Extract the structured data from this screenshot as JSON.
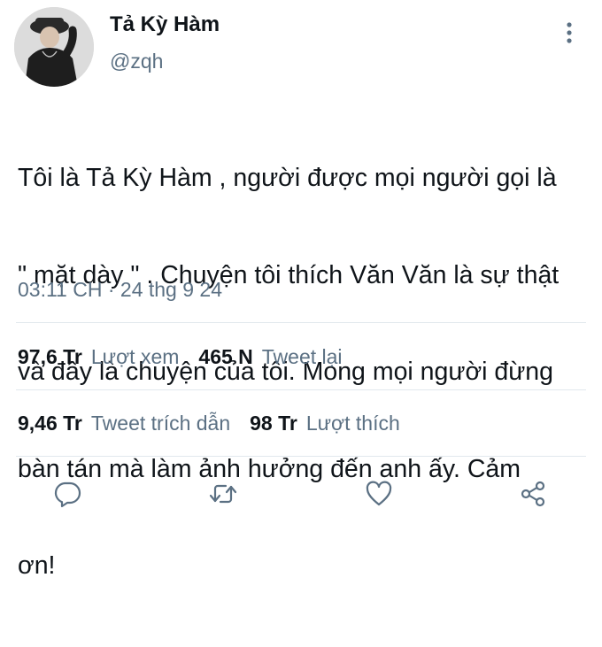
{
  "author": {
    "display_name": "Tả Kỳ Hàm",
    "handle": "@zqh",
    "avatar_icon": "avatar-photo"
  },
  "menu": {
    "icon": "more-vertical-icon"
  },
  "tweet": {
    "lines": [
      "Tôi là Tả Kỳ Hàm , người được mọi người gọi là",
      "\" mặt dày \" . Chuyện tôi thích Văn Văn là sự thật",
      "và đây là chuyện của tôi. Mong mọi người đừng",
      "bàn tán mà làm ảnh hưởng đến anh ấy. Cảm",
      "ơn!"
    ],
    "timestamp": "03:11 CH · 24 thg 9 24"
  },
  "stats": {
    "views_value": "97,6 Tr",
    "views_label": "Lượt xem",
    "retweets_value": "465 N",
    "retweets_label": "Tweet lại",
    "quotes_value": "9,46 Tr",
    "quotes_label": "Tweet trích dẫn",
    "likes_value": "98 Tr",
    "likes_label": "Lượt thích"
  },
  "actions": {
    "reply_icon": "reply-icon",
    "retweet_icon": "retweet-icon",
    "like_icon": "like-heart-icon",
    "share_icon": "share-icon"
  },
  "colors": {
    "text_primary": "#0f1419",
    "text_secondary": "#5b7083",
    "divider": "#e1e8ed",
    "icon": "#5b7083"
  }
}
